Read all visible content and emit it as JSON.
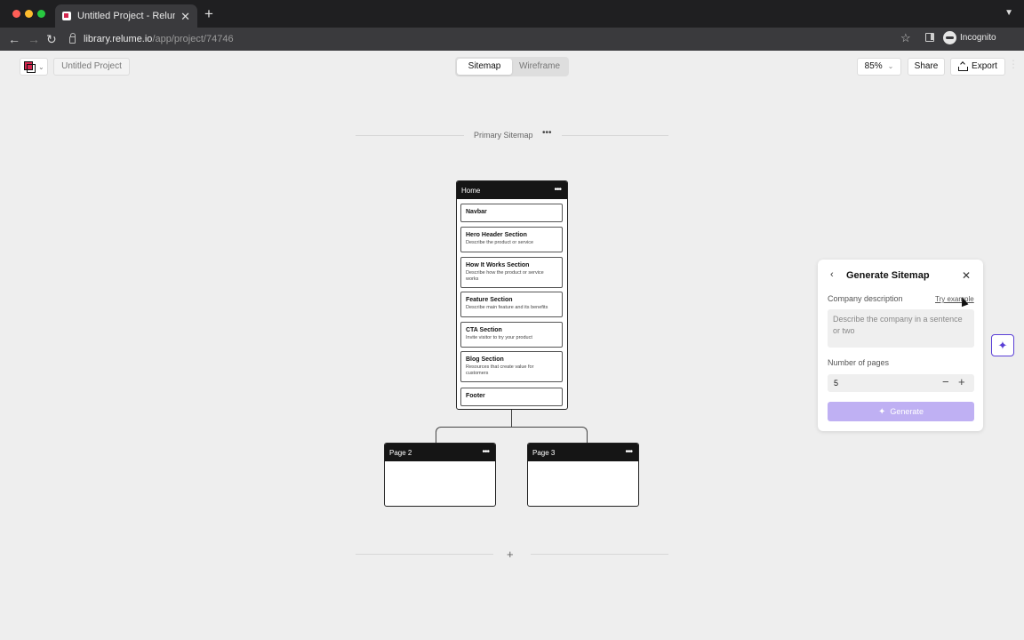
{
  "browser": {
    "tab_title": "Untitled Project - Relume Bloc",
    "tab_close": "✕",
    "new_tab": "+",
    "url_host": "library.relume.io",
    "url_path": "/app/project/74746",
    "profile_label": "Incognito"
  },
  "header": {
    "project_name": "Untitled Project",
    "view_tabs": [
      {
        "label": "Sitemap",
        "active": true
      },
      {
        "label": "Wireframe",
        "active": false
      }
    ],
    "zoom": "85%",
    "share_label": "Share",
    "export_label": "Export"
  },
  "canvas": {
    "sitemap_title": "Primary Sitemap",
    "home": {
      "title": "Home",
      "sections": [
        {
          "title": "Navbar",
          "desc": ""
        },
        {
          "title": "Hero Header Section",
          "desc": "Describe the product or service"
        },
        {
          "title": "How It Works Section",
          "desc": "Describe how the product or service works"
        },
        {
          "title": "Feature Section",
          "desc": "Describe main feature and its benefits"
        },
        {
          "title": "CTA Section",
          "desc": "Invite visitor to try your product"
        },
        {
          "title": "Blog Section",
          "desc": "Resources that create value for customers"
        },
        {
          "title": "Footer",
          "desc": ""
        }
      ]
    },
    "child_pages": [
      {
        "title": "Page 2"
      },
      {
        "title": "Page 3"
      }
    ],
    "add_symbol": "+"
  },
  "panel": {
    "title": "Generate Sitemap",
    "company_label": "Company description",
    "try_example": "Try example",
    "company_placeholder": "Describe the company in a sentence or two",
    "pages_label": "Number of pages",
    "pages_value": "5",
    "generate_label": "Generate",
    "accent_color": "#bfb0f3"
  }
}
